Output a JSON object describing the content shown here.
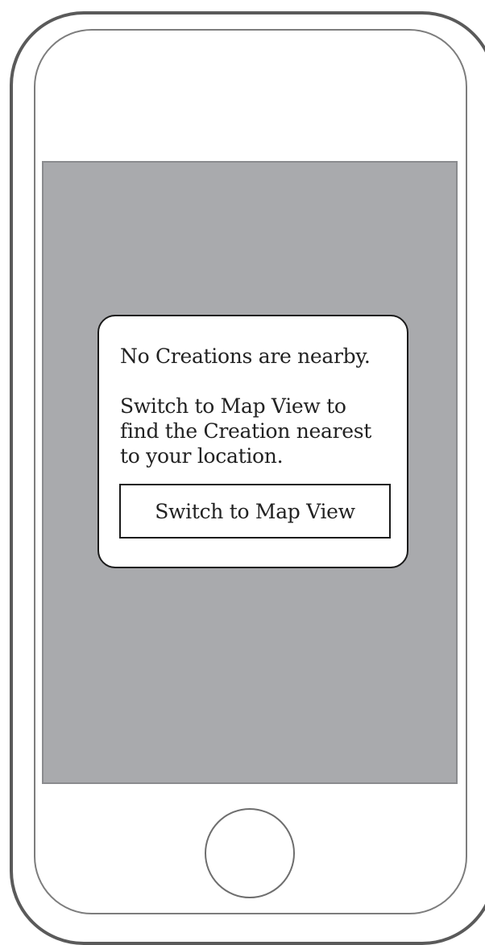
{
  "dialog": {
    "message_line1": "No Creations are nearby.",
    "message_line2": "Switch to Map View to",
    "message_line3": "find the Creation nearest",
    "message_line4": "to your location.",
    "button_label": "Switch to Map View"
  },
  "colors": {
    "screen_background": "#a9aaad",
    "dialog_background": "#ffffff",
    "frame_stroke": "#5a5a5a"
  }
}
